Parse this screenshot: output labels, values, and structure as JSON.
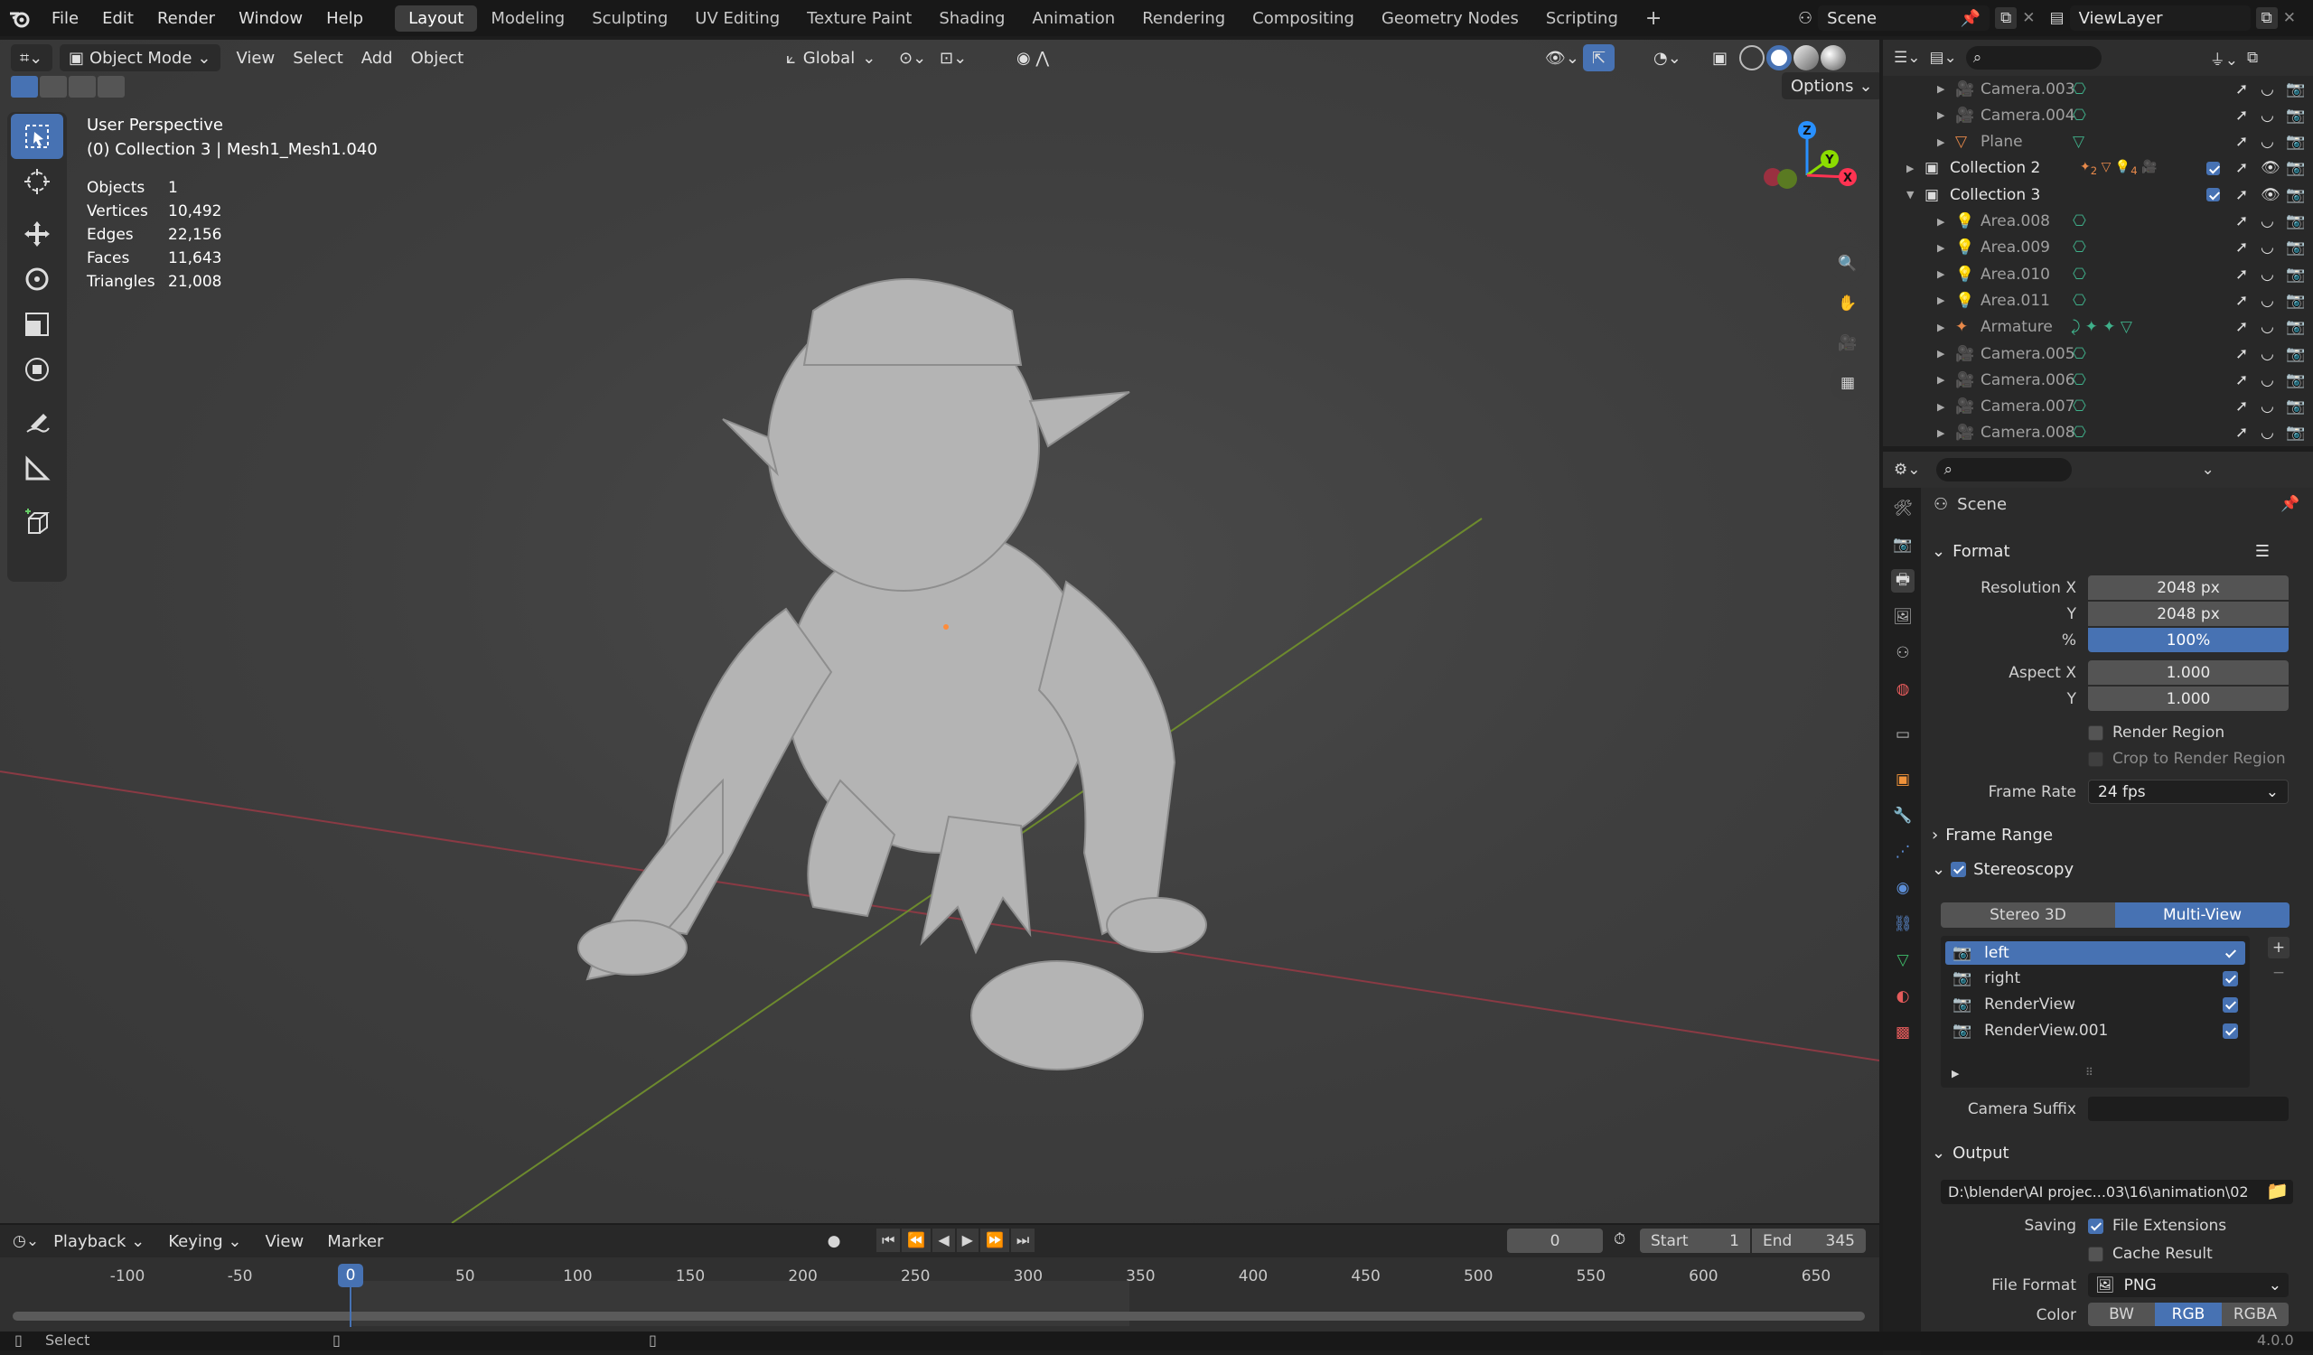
{
  "topbar": {
    "menus": [
      "File",
      "Edit",
      "Render",
      "Window",
      "Help"
    ],
    "workspaces": [
      "Layout",
      "Modeling",
      "Sculpting",
      "UV Editing",
      "Texture Paint",
      "Shading",
      "Animation",
      "Rendering",
      "Compositing",
      "Geometry Nodes",
      "Scripting"
    ],
    "active_workspace": "Layout",
    "add_tab": "+",
    "scene": "Scene",
    "view_layer": "ViewLayer"
  },
  "viewport_header": {
    "mode": "Object Mode",
    "menus": [
      "View",
      "Select",
      "Add",
      "Object"
    ],
    "orientation": "Global",
    "options": "Options"
  },
  "overlay": {
    "perspective": "User Perspective",
    "collection": "(0) Collection 3 | Mesh1_Mesh1.040",
    "stats": [
      {
        "label": "Objects",
        "value": "1"
      },
      {
        "label": "Vertices",
        "value": "10,492"
      },
      {
        "label": "Edges",
        "value": "22,156"
      },
      {
        "label": "Faces",
        "value": "11,643"
      },
      {
        "label": "Triangles",
        "value": "21,008"
      }
    ]
  },
  "gizmo": {
    "z": "Z",
    "y": "Y",
    "x": "X"
  },
  "outliner": {
    "rows": [
      {
        "label": "Camera.003",
        "type": "camera",
        "indent": 2
      },
      {
        "label": "Camera.004",
        "type": "camera",
        "indent": 2
      },
      {
        "label": "Plane",
        "type": "mesh",
        "indent": 2
      },
      {
        "label": "Collection 2",
        "type": "collection",
        "indent": 1
      },
      {
        "label": "Collection 3",
        "type": "collection",
        "indent": 1
      },
      {
        "label": "Area.008",
        "type": "light",
        "indent": 2
      },
      {
        "label": "Area.009",
        "type": "light",
        "indent": 2
      },
      {
        "label": "Area.010",
        "type": "light",
        "indent": 2
      },
      {
        "label": "Area.011",
        "type": "light",
        "indent": 2
      },
      {
        "label": "Armature",
        "type": "armature",
        "indent": 2
      },
      {
        "label": "Camera.005",
        "type": "camera",
        "indent": 2
      },
      {
        "label": "Camera.006",
        "type": "camera",
        "indent": 2
      },
      {
        "label": "Camera.007",
        "type": "camera",
        "indent": 2
      },
      {
        "label": "Camera.008",
        "type": "camera",
        "indent": 2
      }
    ],
    "collection2_badges": [
      "2",
      "4"
    ]
  },
  "properties": {
    "context": "Scene",
    "format": {
      "title": "Format",
      "resolution_x_label": "Resolution X",
      "resolution_x": "2048 px",
      "y_label": "Y",
      "resolution_y": "2048 px",
      "percent_label": "%",
      "percent": "100%",
      "aspect_x_label": "Aspect X",
      "aspect_x": "1.000",
      "aspect_y_label": "Y",
      "aspect_y": "1.000",
      "render_region": "Render Region",
      "crop_region": "Crop to Render Region",
      "frame_rate_label": "Frame Rate",
      "frame_rate": "24 fps"
    },
    "frame_range": "Frame Range",
    "stereoscopy": {
      "title": "Stereoscopy",
      "modes": [
        "Stereo 3D",
        "Multi-View"
      ],
      "active_mode": "Multi-View",
      "views": [
        "left",
        "right",
        "RenderView",
        "RenderView.001"
      ],
      "camera_suffix_label": "Camera Suffix",
      "camera_suffix": ""
    },
    "output": {
      "title": "Output",
      "path": "D:\\blender\\AI projec...03\\16\\animation\\02",
      "saving_label": "Saving",
      "file_extensions": "File Extensions",
      "cache_result": "Cache Result",
      "file_format_label": "File Format",
      "file_format": "PNG",
      "color_label": "Color",
      "color_modes": [
        "BW",
        "RGB",
        "RGBA"
      ],
      "active_color": "RGB"
    }
  },
  "timeline": {
    "menus": [
      "Playback",
      "Keying",
      "View",
      "Marker"
    ],
    "current_frame": "0",
    "start_label": "Start",
    "start": "1",
    "end_label": "End",
    "end": "345",
    "ticks": [
      "-100",
      "-50",
      "0",
      "50",
      "100",
      "150",
      "200",
      "250",
      "300",
      "350",
      "400",
      "450",
      "500",
      "550",
      "600",
      "650"
    ]
  },
  "statusbar": {
    "left": "Select",
    "version": "4.0.0"
  },
  "colors": {
    "accent": "#4772b3",
    "axis_x": "#ff3352",
    "axis_y": "#8bdc00",
    "axis_z": "#2890ff"
  }
}
